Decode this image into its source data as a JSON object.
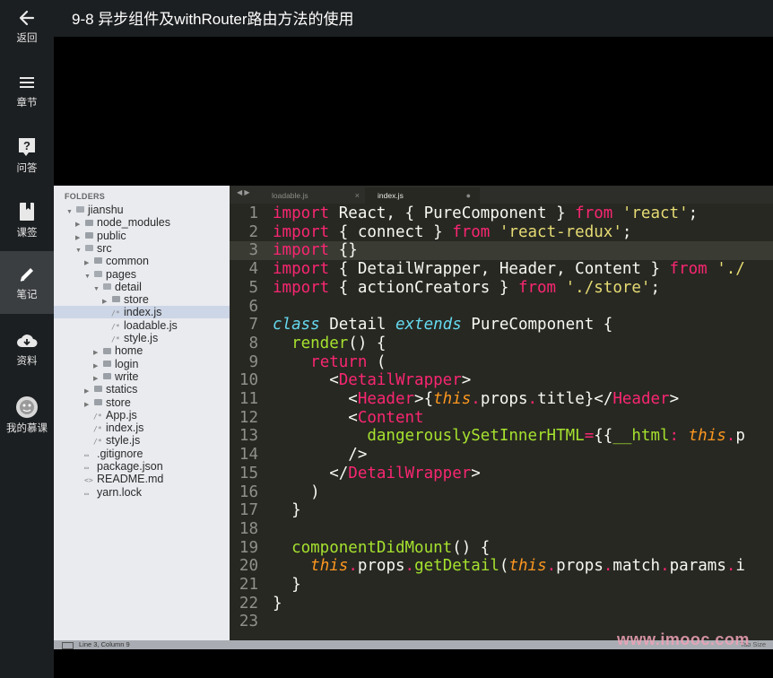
{
  "header": {
    "title": "9-8 异步组件及withRouter路由方法的使用"
  },
  "sidebar": {
    "items": [
      {
        "label": "返回",
        "icon": "back-arrow-icon"
      },
      {
        "label": "章节",
        "icon": "menu-icon"
      },
      {
        "label": "问答",
        "icon": "question-icon"
      },
      {
        "label": "课签",
        "icon": "bookmark-icon"
      },
      {
        "label": "笔记",
        "icon": "pencil-icon",
        "active": true
      },
      {
        "label": "资料",
        "icon": "cloud-download-icon"
      },
      {
        "label": "我的慕课",
        "icon": "mooc-avatar-icon"
      }
    ]
  },
  "editor": {
    "folders_title": "FOLDERS",
    "tabs": [
      {
        "label": "loadable.js",
        "close": "×"
      },
      {
        "label": "index.js",
        "close": "●",
        "active": true
      }
    ],
    "tree": [
      {
        "label": "jianshu",
        "depth": 0,
        "type": "folder-open"
      },
      {
        "label": "node_modules",
        "depth": 1,
        "type": "folder"
      },
      {
        "label": "public",
        "depth": 1,
        "type": "folder"
      },
      {
        "label": "src",
        "depth": 1,
        "type": "folder-open"
      },
      {
        "label": "common",
        "depth": 2,
        "type": "folder"
      },
      {
        "label": "pages",
        "depth": 2,
        "type": "folder-open"
      },
      {
        "label": "detail",
        "depth": 3,
        "type": "folder-open"
      },
      {
        "label": "store",
        "depth": 4,
        "type": "folder"
      },
      {
        "label": "index.js",
        "depth": 4,
        "type": "file-js",
        "selected": true
      },
      {
        "label": "loadable.js",
        "depth": 4,
        "type": "file-js"
      },
      {
        "label": "style.js",
        "depth": 4,
        "type": "file-js"
      },
      {
        "label": "home",
        "depth": 3,
        "type": "folder"
      },
      {
        "label": "login",
        "depth": 3,
        "type": "folder"
      },
      {
        "label": "write",
        "depth": 3,
        "type": "folder"
      },
      {
        "label": "statics",
        "depth": 2,
        "type": "folder"
      },
      {
        "label": "store",
        "depth": 2,
        "type": "folder"
      },
      {
        "label": "App.js",
        "depth": 2,
        "type": "file-js"
      },
      {
        "label": "index.js",
        "depth": 2,
        "type": "file-js"
      },
      {
        "label": "style.js",
        "depth": 2,
        "type": "file-js"
      },
      {
        "label": ".gitignore",
        "depth": 1,
        "type": "file"
      },
      {
        "label": "package.json",
        "depth": 1,
        "type": "file"
      },
      {
        "label": "README.md",
        "depth": 1,
        "type": "file-md"
      },
      {
        "label": "yarn.lock",
        "depth": 1,
        "type": "file"
      }
    ],
    "code_lines": [
      "import React, { PureComponent } from 'react';",
      "import { connect } from 'react-redux';",
      "import {}",
      "import { DetailWrapper, Header, Content } from './",
      "import { actionCreators } from './store';",
      "",
      "class Detail extends PureComponent {",
      "  render() {",
      "    return (",
      "      <DetailWrapper>",
      "        <Header>{this.props.title}</Header>",
      "        <Content",
      "          dangerouslySetInnerHTML={{__html: this.p",
      "        />",
      "      </DetailWrapper>",
      "    )",
      "  }",
      "",
      "  componentDidMount() {",
      "    this.props.getDetail(this.props.match.params.i",
      "  }",
      "}",
      ""
    ],
    "current_line": 3,
    "status_text": "Line 3, Column 9",
    "status_right": "Tab Size",
    "watermark": "www.imooc.com"
  },
  "colors": {
    "accent": "#f92672",
    "string": "#e6db74",
    "function": "#a6e22e",
    "keyword_italic": "#66d9ef"
  }
}
